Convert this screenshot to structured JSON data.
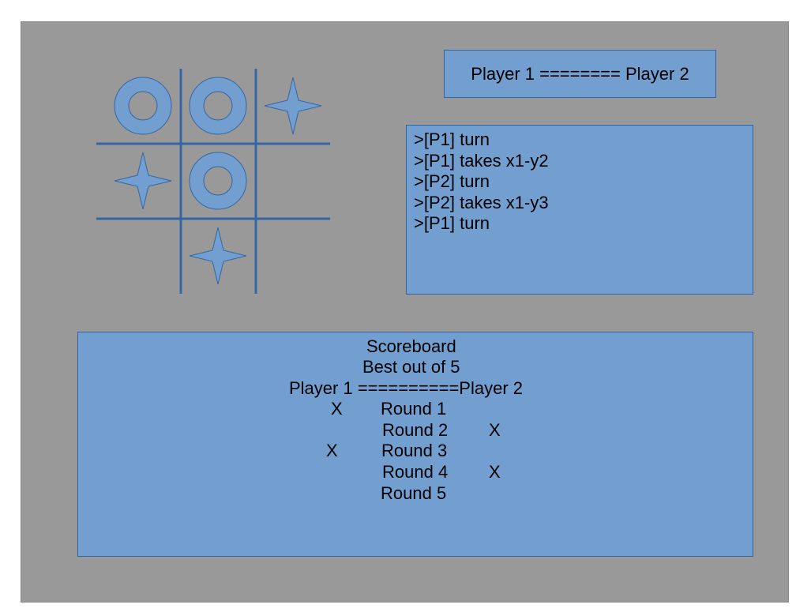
{
  "header": {
    "matchup": "Player 1 ======== Player 2"
  },
  "board": {
    "cells": [
      [
        "O",
        "O",
        "star"
      ],
      [
        "star",
        "O",
        ""
      ],
      [
        "",
        "star",
        ""
      ]
    ],
    "colors": {
      "piece_fill": "#729fcf",
      "piece_stroke": "#3465a4",
      "grid_line": "#3465a4"
    }
  },
  "log": {
    "lines": [
      ">[P1] turn",
      ">[P1] takes x1-y2",
      ">[P2] turn",
      ">[P2] takes x1-y3",
      ">[P1] turn"
    ]
  },
  "scoreboard": {
    "title": "Scoreboard",
    "subtitle": "Best out of 5",
    "matchup": "Player 1 ==========Player 2",
    "rounds": [
      {
        "label": "Round 1",
        "p1": "X",
        "p2": ""
      },
      {
        "label": "Round 2",
        "p1": "",
        "p2": "X"
      },
      {
        "label": "Round 3",
        "p1": "X",
        "p2": ""
      },
      {
        "label": "Round 4",
        "p1": "",
        "p2": "X"
      },
      {
        "label": "Round 5",
        "p1": "",
        "p2": ""
      }
    ]
  },
  "colors": {
    "background": "#999999",
    "panel": "#729fcf",
    "panel_border": "#3465a4"
  }
}
